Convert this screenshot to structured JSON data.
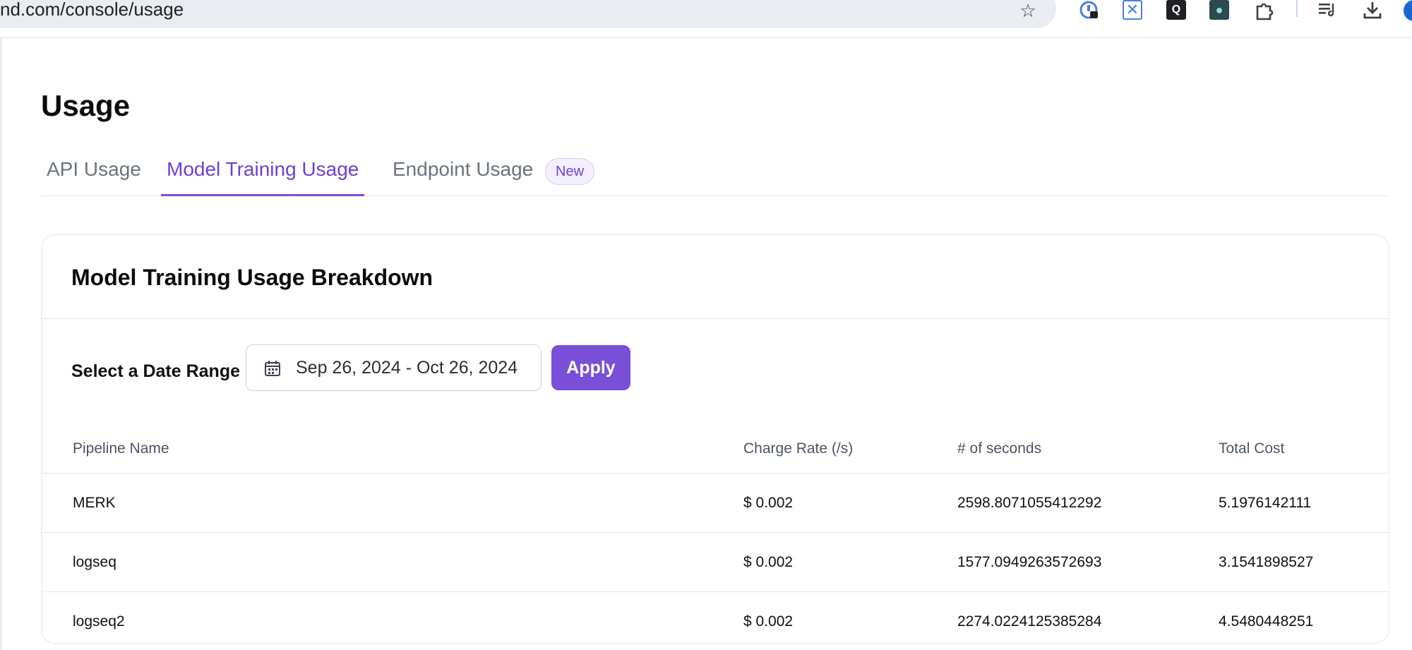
{
  "browser": {
    "url": "nd.com/console/usage",
    "icons": [
      "star-icon",
      "password-manager-icon",
      "x-extension-icon",
      "q-extension-icon",
      "app-extension-icon",
      "puzzle-extensions-icon",
      "reading-list-icon",
      "download-icon",
      "profile-avatar"
    ]
  },
  "page": {
    "title": "Usage"
  },
  "tabs": [
    {
      "label": "API Usage",
      "active": false
    },
    {
      "label": "Model Training Usage",
      "active": true
    },
    {
      "label": "Endpoint Usage",
      "active": false,
      "badge": "New"
    }
  ],
  "card": {
    "title": "Model Training Usage Breakdown",
    "date_label": "Select a Date Range",
    "date_range": "Sep 26, 2024 - Oct 26, 2024",
    "apply_label": "Apply"
  },
  "table": {
    "headers": [
      "Pipeline Name",
      "Charge Rate (/s)",
      "# of seconds",
      "Total Cost"
    ],
    "rows": [
      [
        "MERK",
        "$ 0.002",
        "2598.8071055412292",
        "5.1976142111"
      ],
      [
        "logseq",
        "$ 0.002",
        "1577.0949263572693",
        "3.1541898527"
      ],
      [
        "logseq2",
        "$ 0.002",
        "2274.0224125385284",
        "4.5480448251"
      ]
    ]
  },
  "colors": {
    "accent": "#7a4fd8",
    "active_tab": "#6d3fd6",
    "muted_text": "#6b7280"
  }
}
